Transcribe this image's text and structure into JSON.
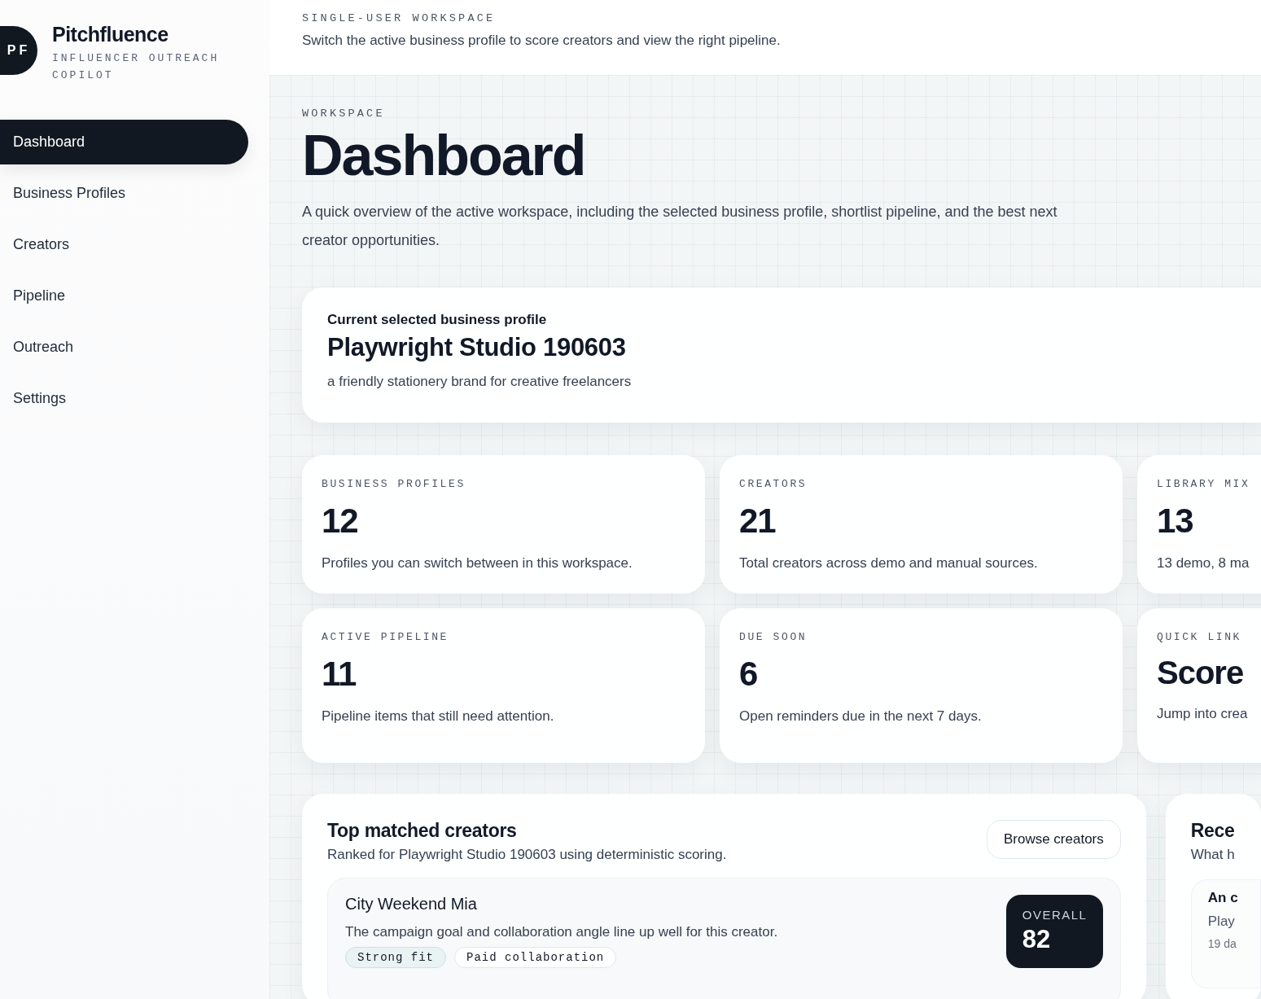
{
  "sidebar": {
    "brand": {
      "initials": "PF",
      "name": "Pitchfluence",
      "tagline": "INFLUENCER OUTREACH COPILOT"
    },
    "nav": [
      {
        "label": "Dashboard",
        "selected": true
      },
      {
        "label": "Business Profiles",
        "selected": false
      },
      {
        "label": "Creators",
        "selected": false
      },
      {
        "label": "Pipeline",
        "selected": false
      },
      {
        "label": "Outreach",
        "selected": false
      },
      {
        "label": "Settings",
        "selected": false
      }
    ]
  },
  "topbar": {
    "eyebrow": "SINGLE-USER WORKSPACE",
    "text": "Switch the active business profile to score creators and view the right pipeline."
  },
  "header": {
    "eyebrow": "WORKSPACE",
    "title": "Dashboard",
    "description": "A quick overview of the active workspace, including the selected business profile, shortlist pipeline, and the best next creator opportunities."
  },
  "profile_card": {
    "label": "Current selected business profile",
    "name": "Playwright Studio 190603",
    "description": "a friendly stationery brand for creative freelancers"
  },
  "stats": [
    {
      "kind": "number",
      "label": "BUSINESS PROFILES",
      "value": "12",
      "note": "Profiles you can switch between in this workspace."
    },
    {
      "kind": "number",
      "label": "CREATORS",
      "value": "21",
      "note": "Total creators across demo and manual sources."
    },
    {
      "kind": "number",
      "label": "LIBRARY MIX",
      "value": "13",
      "note": "13 demo, 8 ma"
    },
    {
      "kind": "number",
      "label": "ACTIVE PIPELINE",
      "value": "11",
      "note": "Pipeline items that still need attention."
    },
    {
      "kind": "number",
      "label": "DUE SOON",
      "value": "6",
      "note": "Open reminders due in the next 7 days."
    },
    {
      "kind": "link",
      "label": "QUICK LINK",
      "value": "Score",
      "note": "Jump into crea"
    }
  ],
  "top_matches": {
    "title": "Top matched creators",
    "subtitle": "Ranked for Playwright Studio 190603 using deterministic scoring.",
    "button": "Browse creators",
    "creators": [
      {
        "name": "City Weekend Mia",
        "reason": "The campaign goal and collaboration angle line up well for this creator.",
        "score_label": "OVERALL",
        "score": "82",
        "tags": [
          {
            "label": "Strong fit",
            "highlighted": true
          },
          {
            "label": "Paid collaboration",
            "highlighted": false
          }
        ]
      }
    ]
  },
  "recent": {
    "title": "Rece",
    "subtitle": "What h",
    "items": [
      {
        "title": "An c",
        "text": "Play",
        "meta": "19 da"
      }
    ]
  }
}
